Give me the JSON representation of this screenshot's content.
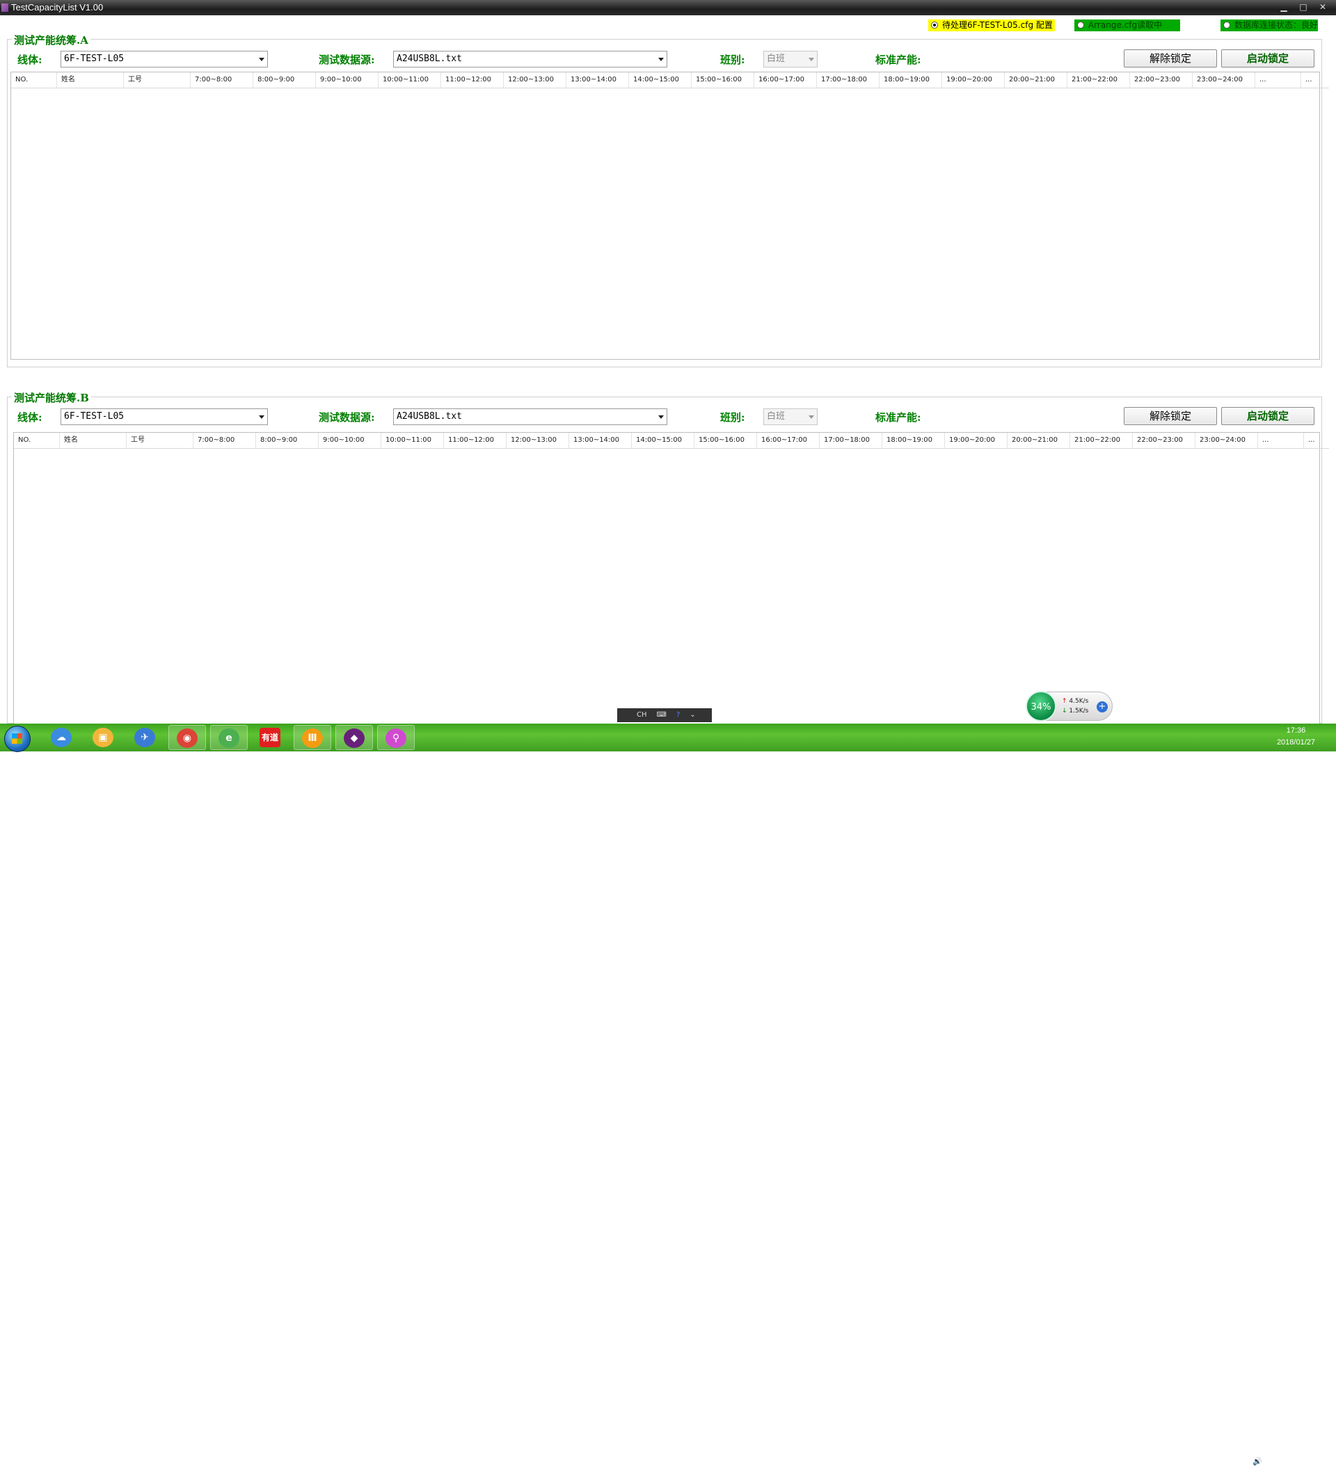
{
  "window": {
    "title": "TestCapacityList V1.00",
    "controls": [
      "▁",
      "□",
      "✕"
    ]
  },
  "status": [
    {
      "label": "待处理6F-TEST-L05.cfg 配置",
      "color": "#ffff00",
      "active": true
    },
    {
      "label": "Arrange.cfg读取中",
      "color": "#00aa00",
      "active": false
    },
    {
      "label": "数据库连接状态：良好",
      "color": "#00aa00",
      "active": false
    }
  ],
  "panels": [
    {
      "title": "测试产能统筹.A",
      "line_label": "线体:",
      "line_value": "6F-TEST-L05",
      "source_label": "测试数据源:",
      "source_value": "A24USB8L.txt",
      "shift_label": "班别:",
      "shift_value": "白班",
      "capacity_label": "标准产能:",
      "unlock_label": "解除锁定",
      "lock_label": "启动锁定",
      "columns": [
        "NO.",
        "姓名",
        "工号",
        "7:00~8:00",
        "8:00~9:00",
        "9:00~10:00",
        "10:00~11:00",
        "11:00~12:00",
        "12:00~13:00",
        "13:00~14:00",
        "14:00~15:00",
        "15:00~16:00",
        "16:00~17:00",
        "17:00~18:00",
        "18:00~19:00",
        "19:00~20:00",
        "20:00~21:00",
        "21:00~22:00",
        "22:00~23:00",
        "23:00~24:00",
        "...",
        "..."
      ]
    },
    {
      "title": "测试产能统筹.B",
      "line_label": "线体:",
      "line_value": "6F-TEST-L05",
      "source_label": "测试数据源:",
      "source_value": "A24USB8L.txt",
      "shift_label": "班别:",
      "shift_value": "白班",
      "capacity_label": "标准产能:",
      "unlock_label": "解除锁定",
      "lock_label": "启动锁定",
      "columns": [
        "NO.",
        "姓名",
        "工号",
        "7:00~8:00",
        "8:00~9:00",
        "9:00~10:00",
        "10:00~11:00",
        "11:00~12:00",
        "12:00~13:00",
        "13:00~14:00",
        "14:00~15:00",
        "15:00~16:00",
        "16:00~17:00",
        "17:00~18:00",
        "18:00~19:00",
        "19:00~20:00",
        "20:00~21:00",
        "21:00~22:00",
        "22:00~23:00",
        "23:00~24:00",
        "...",
        "..."
      ]
    }
  ],
  "ime": {
    "lang": "CH",
    "keyboard": "⌨",
    "help": "?",
    "menu": "⌄"
  },
  "net_widget": {
    "percent": "34%",
    "up": "4.5K/s",
    "down": "1.5K/s",
    "plus": "+"
  },
  "taskbar": {
    "apps": [
      {
        "icon": "baidu-netdisk-icon",
        "glyph": "☁",
        "color": "#3b8be0"
      },
      {
        "icon": "folder-icon",
        "glyph": "▣",
        "color": "#f2b53a"
      },
      {
        "icon": "bird-icon",
        "glyph": "✈",
        "color": "#3a7bd5"
      },
      {
        "icon": "chrome-icon",
        "glyph": "◉",
        "color": "#db4437"
      },
      {
        "icon": "browser-icon",
        "glyph": "e",
        "color": "#4caf50"
      },
      {
        "icon": "youdao-icon",
        "glyph": "有道",
        "color": "#e02020"
      },
      {
        "icon": "app-orange-icon",
        "glyph": "Ⅲ",
        "color": "#f39c12"
      },
      {
        "icon": "visual-studio-icon",
        "glyph": "◆",
        "color": "#68217a"
      },
      {
        "icon": "search-tool-icon",
        "glyph": "⚲",
        "color": "#d04ad0"
      }
    ],
    "tray_icons": [
      "▲",
      "●",
      "🌡",
      "●",
      "⛨",
      "▦",
      "★",
      "▭",
      "🔊"
    ],
    "time": "17:36",
    "date": "2018/01/27"
  }
}
